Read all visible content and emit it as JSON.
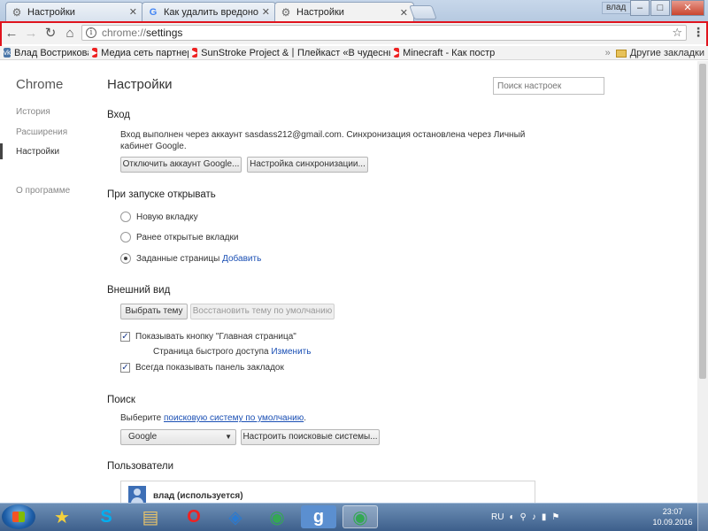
{
  "tabs": [
    {
      "label": "Настройки",
      "icon": "gear-icon"
    },
    {
      "label": "Как удалить вредоносн",
      "icon": "google-icon"
    },
    {
      "label": "Настройки",
      "icon": "gear-icon"
    }
  ],
  "window": {
    "user": "влад"
  },
  "address": {
    "scheme": "chrome://",
    "path": "settings"
  },
  "bookmarks": [
    {
      "label": "Влад Вострикова",
      "color": "#4a76a8",
      "icon": "vk-icon"
    },
    {
      "label": "Медиа сеть партнер",
      "color": "#e22",
      "icon": "youtube-icon"
    },
    {
      "label": "SunStroke Project & С",
      "color": "#e22",
      "icon": "youtube-icon"
    },
    {
      "label": "Плейкаст «В чудесны",
      "color": "#999",
      "icon": "page-icon"
    },
    {
      "label": "Minecraft - Как постр",
      "color": "#e22",
      "icon": "youtube-icon"
    }
  ],
  "bookmarks_other": "Другие закладки",
  "sidebar": {
    "title": "Chrome",
    "items": [
      "История",
      "Расширения",
      "Настройки",
      "О программе"
    ]
  },
  "settings": {
    "title": "Настройки",
    "search_placeholder": "Поиск настроек",
    "signin": {
      "heading": "Вход",
      "text": "Вход выполнен через аккаунт sasdass212@gmail.com. Синхронизация остановлена через Личный кабинет Google.",
      "disconnect": "Отключить аккаунт Google...",
      "sync": "Настройка синхронизации..."
    },
    "startup": {
      "heading": "При запуске открывать",
      "opt1": "Новую вкладку",
      "opt2": "Ранее открытые вкладки",
      "opt3": "Заданные страницы",
      "opt3_link": "Добавить"
    },
    "appearance": {
      "heading": "Внешний вид",
      "choose_theme": "Выбрать тему",
      "reset_theme": "Восстановить тему по умолчанию",
      "show_home": "Показывать кнопку \"Главная страница\"",
      "quick_access": "Страница быстрого доступа",
      "change": "Изменить",
      "show_bookmarks": "Всегда показывать панель закладок"
    },
    "search": {
      "heading": "Поиск",
      "text_before": "Выберите",
      "text_link": "поисковую систему по умолчанию",
      "text_after": ".",
      "engine": "Google",
      "manage": "Настроить поисковые системы..."
    },
    "users": {
      "heading": "Пользователи",
      "current": "влад (используется)"
    }
  },
  "taskbar": {
    "lang": "RU",
    "time": "23:07",
    "date": "10.09.2016"
  }
}
